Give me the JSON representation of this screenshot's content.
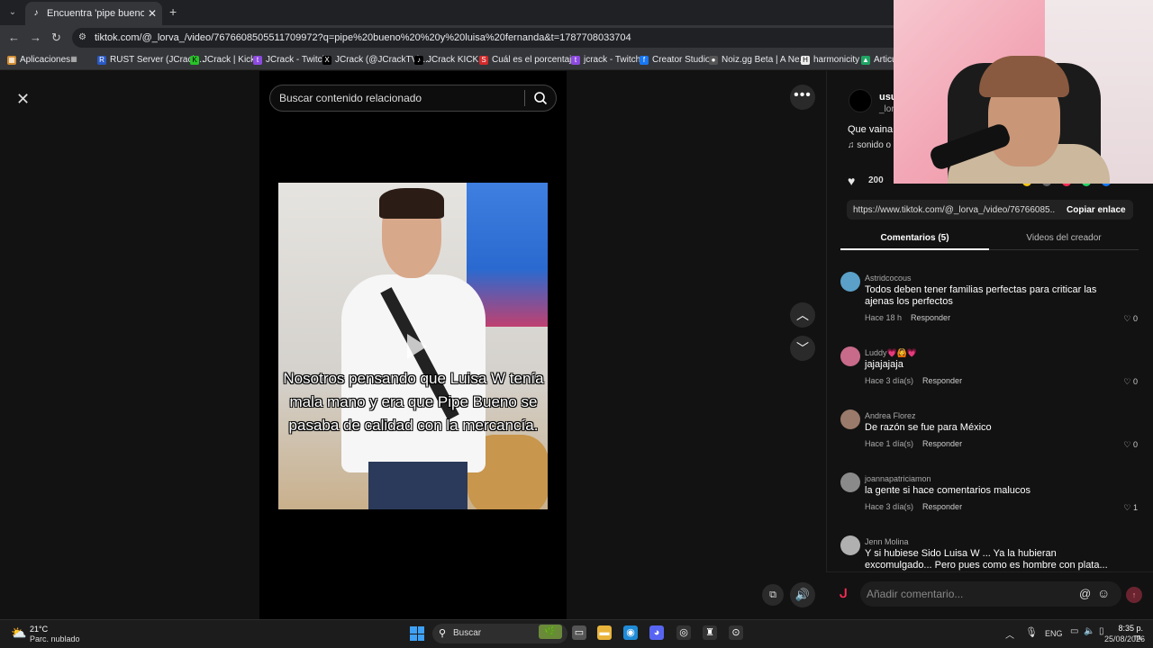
{
  "browser": {
    "tab_title": "Encuentra 'pipe bueno y luisa fe",
    "url": "tiktok.com/@_lorva_/video/7676608505511709972?q=pipe%20bueno%20%20y%20luisa%20fernanda&t=1787708033704",
    "bookmarks": [
      {
        "label": "Aplicaciones",
        "icon": "grid-icon"
      },
      {
        "label": "RUST Server (JCrack...",
        "icon": "rust-icon"
      },
      {
        "label": "JCrack | Kick",
        "icon": "kick-icon"
      },
      {
        "label": "JCrack - Twitch",
        "icon": "twitch-icon"
      },
      {
        "label": "JCrack (@JCrackTV)...",
        "icon": "x-icon"
      },
      {
        "label": "JCrack KICKS",
        "icon": "tiktok-icon"
      },
      {
        "label": "Cuál es el porcentaj...",
        "icon": "s-icon"
      },
      {
        "label": "jcrack - Twitch",
        "icon": "twitch-icon"
      },
      {
        "label": "Creator Studio",
        "icon": "facebook-icon"
      },
      {
        "label": "Noiz.gg Beta | A Ne...",
        "icon": "noiz-icon"
      },
      {
        "label": "harmonicity",
        "icon": "h-icon"
      },
      {
        "label": "Articul",
        "icon": "drive-icon"
      }
    ]
  },
  "player": {
    "search_placeholder": "Buscar contenido relacionado",
    "caption": "Nosotros pensando que Luisa W tenía mala mano y era que Pipe Bueno se pasaba de calidad con la mercancía."
  },
  "author": {
    "name": "usu",
    "handle": "_lor",
    "description": "Que vaina",
    "description_tag": "#",
    "sound": "sonido o",
    "likes": "200"
  },
  "share": {
    "link": "https://www.tiktok.com/@_lorva_/video/76766085...",
    "copy_label": "Copiar enlace"
  },
  "tabs": {
    "comments": "Comentarios (5)",
    "creator": "Videos del creador"
  },
  "comments": [
    {
      "user": "Astridcocous",
      "text": "Todos deben tener familias perfectas para criticar las ajenas los perfectos",
      "time": "Hace 18 h",
      "reply": "Responder",
      "likes": "0"
    },
    {
      "user": "Luddy💗🙆💗",
      "text": "jajajajaja",
      "time": "Hace 3 día(s)",
      "reply": "Responder",
      "likes": "0"
    },
    {
      "user": "Andrea Florez",
      "text": "De razón se fue para México",
      "time": "Hace 1 día(s)",
      "reply": "Responder",
      "likes": "0"
    },
    {
      "user": "joannapatriciamon",
      "text": "la gente si hace comentarios malucos",
      "time": "Hace 3 día(s)",
      "reply": "Responder",
      "likes": "1"
    },
    {
      "user": "Jenn Molina",
      "text": "Y si hubiese Sido Luisa W ... Ya la hubieran excomulgado... Pero pues como es hombre con plata... Pues no pasa",
      "time": "",
      "reply": "",
      "likes": ""
    }
  ],
  "comment_box": {
    "placeholder": "Añadir comentario..."
  },
  "taskbar": {
    "temp": "21°C",
    "weather": "Parc. nublado",
    "search": "Buscar",
    "lang": "ENG",
    "time": "8:35 p. m.",
    "date": "25/08/2026"
  }
}
